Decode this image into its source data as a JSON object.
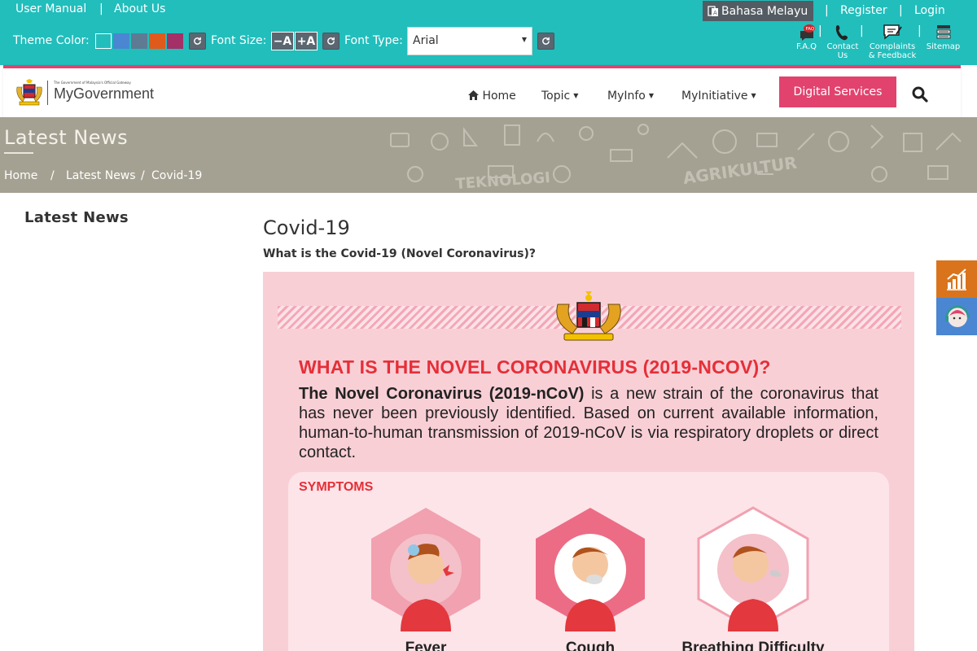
{
  "topbar": {
    "user_manual": "User Manual",
    "about_us": "About Us",
    "theme_color_label": "Theme Color:",
    "theme_colors": [
      "#21bebc",
      "#4a86d1",
      "#5f7a93",
      "#e05a1b",
      "#a33067"
    ],
    "font_size_label": "Font Size:",
    "font_minus": "−A",
    "font_plus": "+A",
    "font_type_label": "Font Type:",
    "font_type_value": "Arial",
    "language": "Bahasa Melayu",
    "register": "Register",
    "login": "Login",
    "separator": "|",
    "quick": {
      "faq": "F.A.Q",
      "contact_1": "Contact",
      "contact_2": "Us",
      "complaints_1": "Complaints",
      "complaints_2": "& Feedback",
      "sitemap": "Sitemap"
    },
    "faq_badge": "FAQ"
  },
  "navbar": {
    "logo_text": "MyGovernment",
    "logo_tagline": "The Government of Malaysia's Official Gateway",
    "home": "Home",
    "topic": "Topic",
    "myinfo": "MyInfo",
    "myinitiative": "MyInitiative",
    "digital_services": "Digital Services",
    "accent": "#e2436e"
  },
  "banner": {
    "title": "Latest News",
    "crumbs": [
      "Home",
      "/",
      "Latest News",
      "/",
      "Covid-19"
    ],
    "bg_words": [
      "TEKNOLOGI",
      "AGRIKULTUR"
    ]
  },
  "sidebar": {
    "title": "Latest News"
  },
  "article": {
    "title": "Covid-19",
    "subtitle": "What is the Covid-19 (Novel Coronavirus)?",
    "infographic": {
      "heading": "WHAT IS THE NOVEL CORONAVIRUS (2019-NCOV)?",
      "lead_bold": "The Novel Coronavirus (2019-nCoV)",
      "lead_rest": " is a new strain of the coronavirus that has never been previously identified. Based on current available information, human-to-human transmission of 2019-nCoV is via respiratory droplets or direct contact.",
      "symptoms_title": "SYMPTOMS",
      "symptoms": [
        "Fever",
        "Cough",
        "Breathing Difficulty"
      ]
    }
  },
  "floating": {
    "stats_color": "#d9741c",
    "chat_color": "#4a86d1"
  }
}
